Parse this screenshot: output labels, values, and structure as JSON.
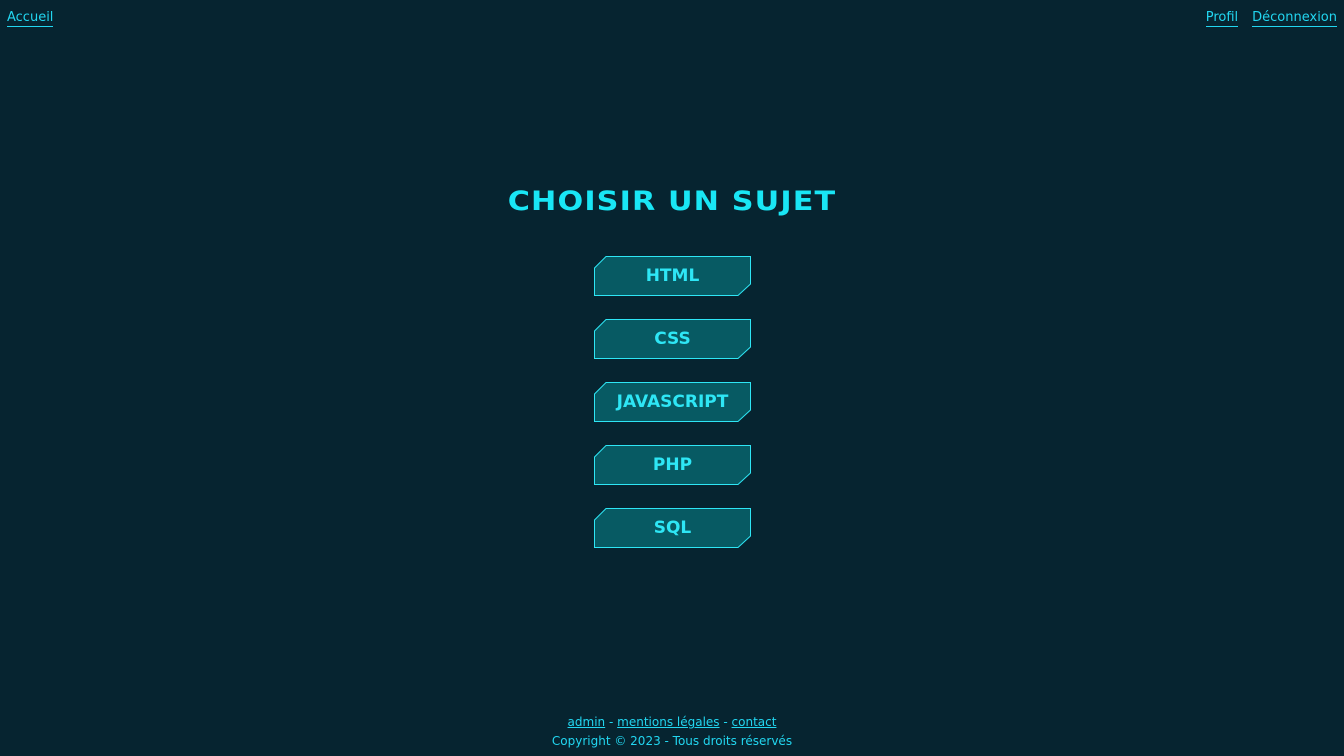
{
  "nav": {
    "home_label": "Accueil",
    "profile_label": "Profil",
    "logout_label": "Déconnexion"
  },
  "main": {
    "title": "CHOISIR UN SUJET",
    "subjects": [
      {
        "label": "HTML"
      },
      {
        "label": "CSS"
      },
      {
        "label": "JAVASCRIPT"
      },
      {
        "label": "PHP"
      },
      {
        "label": "SQL"
      }
    ]
  },
  "footer": {
    "links": [
      {
        "label": "admin"
      },
      {
        "label": "mentions légales"
      },
      {
        "label": "contact"
      }
    ],
    "separator": "-",
    "copyright": "Copyright © 2023 - Tous droits réservés"
  },
  "colors": {
    "background": "#062430",
    "accent": "#22d6f0",
    "button_fill": "#075a63",
    "button_border": "#2ee6f5"
  }
}
